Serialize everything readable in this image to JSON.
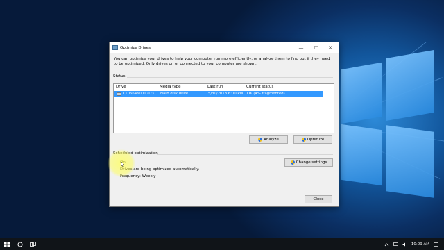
{
  "window": {
    "title": "Optimize Drives",
    "description": "You can optimize your drives to help your computer run more efficiently, or analyze them to find out if they need to be optimized. Only drives on or connected to your computer are shown.",
    "controls": {
      "minimize": "—",
      "maximize": "☐",
      "close": "✕"
    }
  },
  "status": {
    "label": "Status",
    "columns": [
      "Drive",
      "Media type",
      "Last run",
      "Current status"
    ],
    "rows": [
      {
        "drive": "T106646000 (C:)",
        "media_type": "Hard disk drive",
        "last_run": "5/30/2018 6:00 PM",
        "current_status": "OK (4% fragmented)"
      }
    ],
    "analyze_label": "Analyze",
    "optimize_label": "Optimize"
  },
  "scheduled": {
    "label": "Scheduled optimization",
    "on_label": "On",
    "message": "Drives are being optimized automatically.",
    "frequency": "Frequency: Weekly",
    "change_settings_label": "Change settings"
  },
  "close_label": "Close",
  "taskbar": {
    "time": "10:09 AM"
  },
  "colors": {
    "selection": "#3399ff",
    "desktop": "#0b2f63",
    "taskbar": "#101418"
  }
}
